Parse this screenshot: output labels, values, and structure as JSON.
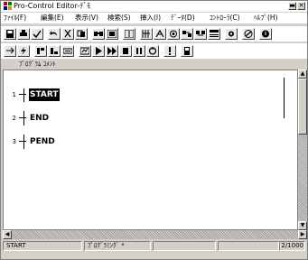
{
  "window": {
    "title": "Pro-Control Editor-ﾃﾞﾓ",
    "app_icon": "pro-control-app-icon",
    "minimize_glyph": "▬",
    "close_glyph": "✕"
  },
  "menu": {
    "items": [
      "ﾌｧｲﾙ(F)",
      "編集(E)",
      "表示(V)",
      "検索(S)",
      "挿入(I)",
      "ﾃﾞｰﾀ(D)",
      "ｺﾝﾄﾛｰﾗ(C)",
      "ﾍﾙﾌﾟ(H)"
    ]
  },
  "toolbar1": {
    "icons": [
      "save-icon",
      "print-icon",
      "check-icon",
      "undo-icon",
      "cut-icon",
      "copy-icon",
      "find-icon",
      "find-replace-icon",
      "insert-icon",
      "ladder-icon",
      "io-icon",
      "compile-icon",
      "transfer-icon",
      "monitor-icon",
      "settings-icon",
      "stop-icon",
      "help-icon"
    ]
  },
  "toolbar2": {
    "icons": [
      "return-icon",
      "lightning-icon",
      "step-icon",
      "step-over-icon",
      "jump-icon",
      "trace-icon",
      "play-icon",
      "fast-forward-icon",
      "stop-square-icon",
      "pause-icon",
      "reset-icon",
      "alert-icon",
      "switch-icon"
    ]
  },
  "editor": {
    "column_header": "ﾌﾟﾛｸﾞﾗﾑ ｺﾒﾝﾄ",
    "lines": [
      {
        "number": "1",
        "text": "START",
        "selected": true
      },
      {
        "number": "2",
        "text": "END",
        "selected": false
      },
      {
        "number": "3",
        "text": "PEND",
        "selected": false
      }
    ]
  },
  "scrollbar": {
    "up_glyph": "▲",
    "down_glyph": "▼",
    "left_glyph": "◀",
    "right_glyph": "▶"
  },
  "statusbar": {
    "current": "START",
    "mode": "ﾌﾟﾛｸﾞﾗﾐﾝｸﾞ *",
    "position": "2/1000"
  }
}
